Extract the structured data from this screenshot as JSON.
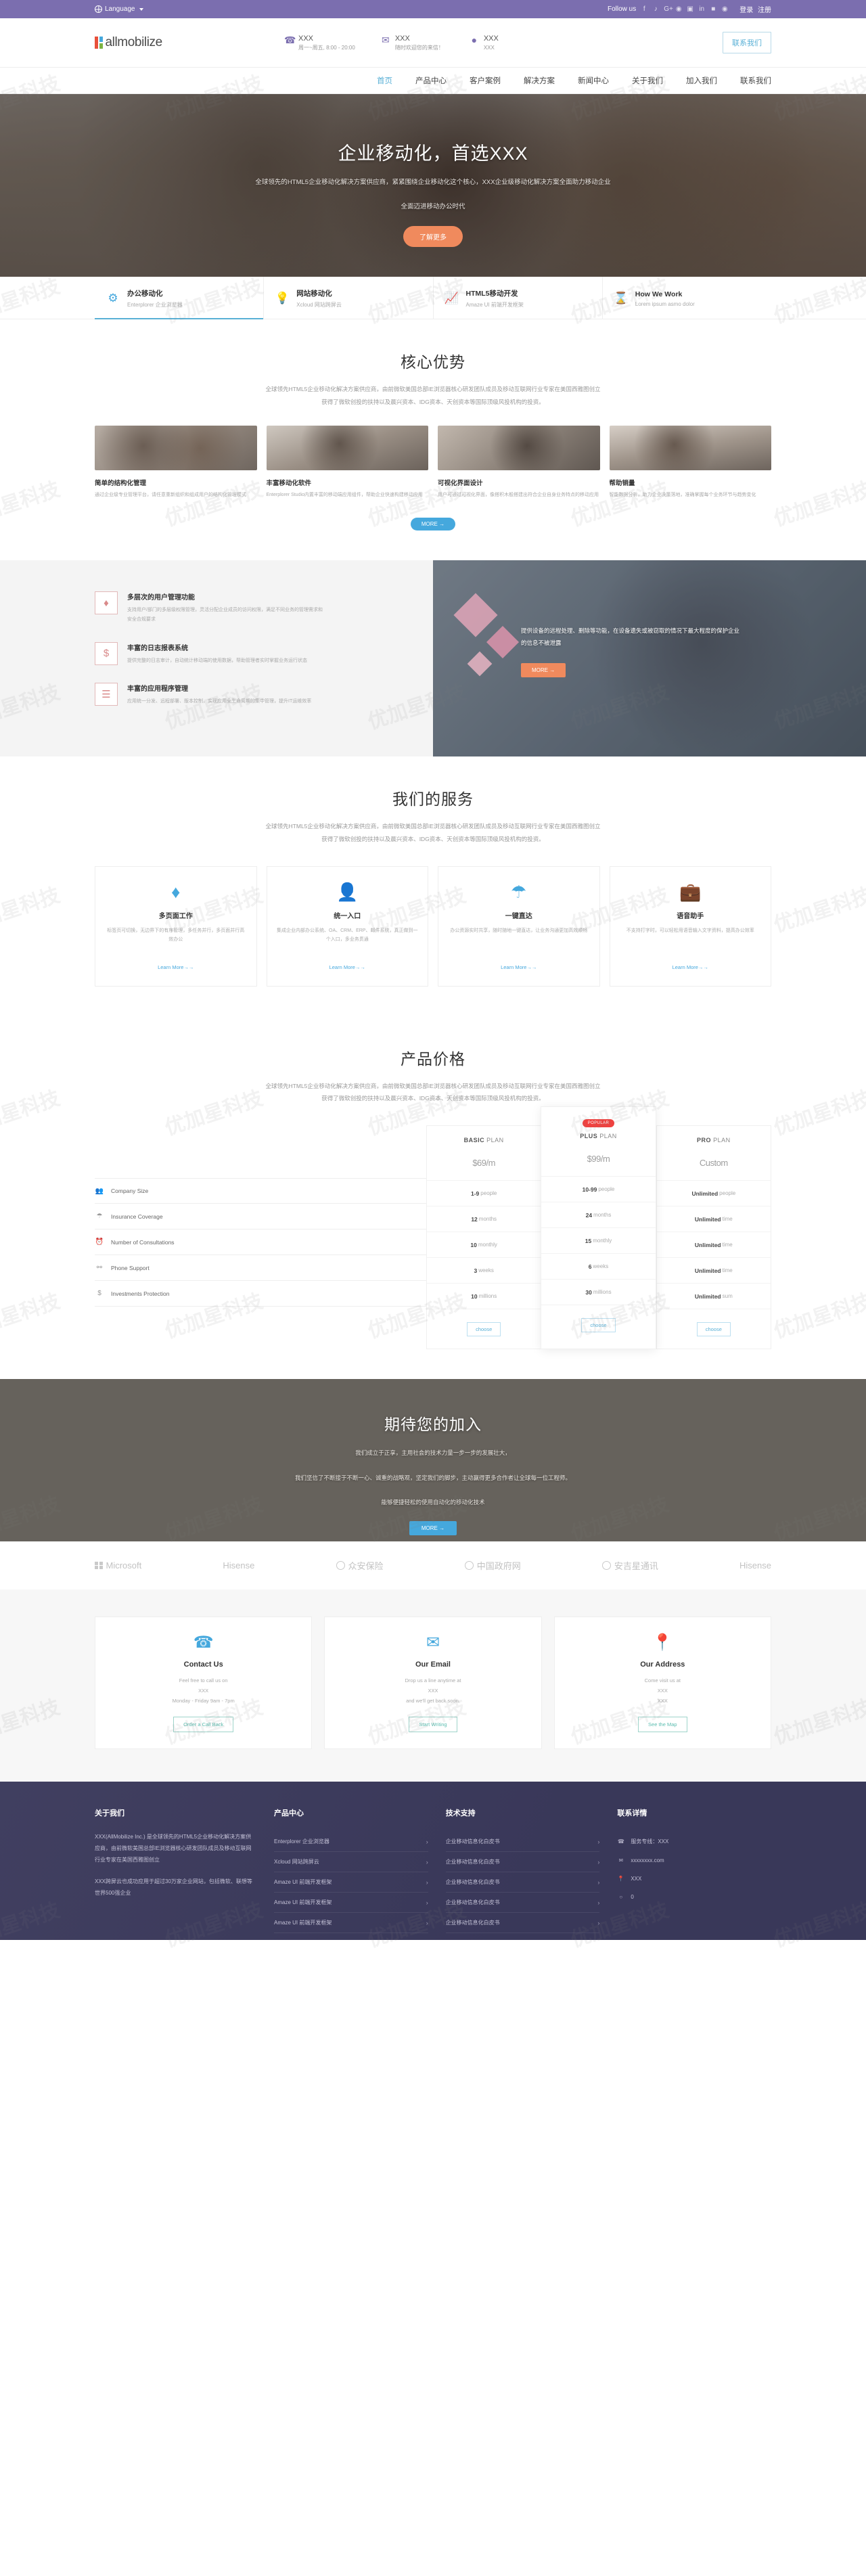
{
  "topbar": {
    "language": "Language",
    "follow_label": "Follow us",
    "social_icons": [
      "facebook-icon",
      "twitter-icon",
      "google-plus-icon",
      "pinterest-icon",
      "instagram-icon",
      "linkedin-icon",
      "flickr-icon",
      "rss-icon"
    ],
    "login": "登录",
    "register": "注册"
  },
  "header": {
    "logo_text": "allmobilize",
    "contacts": [
      {
        "icon": "phone-icon",
        "value": "XXX",
        "note": "周一~周五, 8:00 - 20:00"
      },
      {
        "icon": "envelope-icon",
        "value": "XXX",
        "note": "随时欢迎您的来信！"
      },
      {
        "icon": "location-pin-icon",
        "value": "XXX",
        "note": "XXX"
      }
    ],
    "contact_button": "联系我们"
  },
  "nav": {
    "items": [
      {
        "label": "首页",
        "active": true
      },
      {
        "label": "产品中心",
        "active": false
      },
      {
        "label": "客户案例",
        "active": false
      },
      {
        "label": "解决方案",
        "active": false
      },
      {
        "label": "新闻中心",
        "active": false
      },
      {
        "label": "关于我们",
        "active": false
      },
      {
        "label": "加入我们",
        "active": false
      },
      {
        "label": "联系我们",
        "active": false
      }
    ]
  },
  "hero": {
    "title": "企业移动化，首选XXX",
    "line1": "全球领先的HTML5企业移动化解决方案供应商，紧紧围绕企业移动化这个核心，XXX企业级移动化解决方案全面助力移动企业",
    "line2": "全面迈进移动办公时代",
    "cta": "了解更多"
  },
  "feature_tabs": [
    {
      "icon": "gear-icon",
      "title": "办公移动化",
      "sub": "Enterplorer 企业浏览器",
      "active": true
    },
    {
      "icon": "bulb-icon",
      "title": "网站移动化",
      "sub": "Xcloud 网站跨屏云",
      "active": false
    },
    {
      "icon": "chart-up-icon",
      "title": "HTML5移动开发",
      "sub": "Amaze UI 前端开发框架",
      "active": false
    },
    {
      "icon": "hourglass-icon",
      "title": "How We Work",
      "sub": "Lorem ipsum asmo dolor",
      "active": false
    }
  ],
  "advantages": {
    "title": "核心优势",
    "lead1": "全球领先HTML5企业移动化解决方案供应商，由前微软美国总部IE浏览器核心研发团队成员及移动互联网行业专家在美国西雅图创立",
    "lead2": "获得了微软创投的扶持以及晨兴资本、IDG资本、天创资本等国际顶级风投机构的投资。",
    "cards": [
      {
        "title": "简单的结构化管理",
        "desc": "通过企业级专业管理平台，请任意重新组织和组成用户的结构化管理模式"
      },
      {
        "title": "丰富移动化软件",
        "desc": "Enterplorer Studio内置丰富的移动端应用组件，帮助企业快速构建移动应用"
      },
      {
        "title": "可视化界面设计",
        "desc": "用户可通过可视化界面，像搭积木般搭建出符合企业自身业务特点的移动应用"
      },
      {
        "title": "帮助销量",
        "desc": "智能数据分析，助力企业决策落地，准确掌握每个业务环节与趋势变化"
      }
    ],
    "more": "MORE →"
  },
  "band": {
    "items": [
      {
        "icon": "diamond-icon",
        "title": "多层次的用户管理功能",
        "desc": "支持用户/部门的多层级权限管理，灵活分配企业成员的访问权限，满足不同业务的管理需求和安全合规要求"
      },
      {
        "icon": "dollar-icon",
        "title": "丰富的日志报表系统",
        "desc": "提供完整的日志审计，自动统计移动端的使用数据，帮助管理者实时掌握业务运行状态"
      },
      {
        "icon": "list-icon",
        "title": "丰富的应用程序管理",
        "desc": "应用统一分发、远程部署、版本控制，实现应用全生命周期的集中管理，提升IT运维效率"
      }
    ],
    "quote": "提供设备的远程处理、删除等功能，在设备遗失或被窃取的情况下最大程度的保护企业的信息不被泄露",
    "more": "MORE →"
  },
  "services": {
    "title": "我们的服务",
    "lead1": "全球领先HTML5企业移动化解决方案供应商，由前微软美国总部IE浏览器核心研发团队成员及移动互联网行业专家在美国西雅图创立",
    "lead2": "获得了微软创投的扶持以及晨兴资本、IDG资本、天创资本等国际顶级风投机构的投资。",
    "cards": [
      {
        "icon": "diamond-icon",
        "title": "多页面工作",
        "desc": "标签页可切换，无边界下的有序管理，多任务并行，多页面并行高效办公"
      },
      {
        "icon": "user-icon",
        "title": "统一入口",
        "desc": "集成企业内部办公系统、OA、CRM、ERP、邮件系统，真正做到一个入口，多业务贯通"
      },
      {
        "icon": "umbrella-icon",
        "title": "一键直达",
        "desc": "办公资源实时共享，随时随地一键直达，让业务沟通更加高效顺畅"
      },
      {
        "icon": "briefcase-icon",
        "title": "语音助手",
        "desc": "不支持打字时，可以轻松用语音输入文字资料，提高办公效率"
      }
    ],
    "learn_more": "Learn More→→"
  },
  "pricing": {
    "title": "产品价格",
    "lead1": "全球领先HTML5企业移动化解决方案供应商，由前微软美国总部IE浏览器核心研发团队成员及移动互联网行业专家在美国西雅图创立",
    "lead2": "获得了微软创投的扶持以及晨兴资本、IDG资本、天创资本等国际顶级风投机构的投资。",
    "features": [
      {
        "icon": "people-icon",
        "label": "Company Size"
      },
      {
        "icon": "umbrella-icon",
        "label": "Insurance Coverage"
      },
      {
        "icon": "clock-icon",
        "label": "Number of Consultations"
      },
      {
        "icon": "mic-icon",
        "label": "Phone Support"
      },
      {
        "icon": "dollar-icon",
        "label": "Investments Protection"
      }
    ],
    "plans": [
      {
        "badge": "",
        "name_bold": "BASIC",
        "name_rest": "PLAN",
        "price": "$69",
        "price_unit": "/m",
        "popular": false,
        "cells": [
          {
            "b": "1-9",
            "t": "people"
          },
          {
            "b": "12",
            "t": "months"
          },
          {
            "b": "10",
            "t": "monthly"
          },
          {
            "b": "3",
            "t": "weeks"
          },
          {
            "b": "10",
            "t": "millions"
          }
        ],
        "button": "choose"
      },
      {
        "badge": "POPULAR",
        "name_bold": "PLUS",
        "name_rest": "PLAN",
        "price": "$99",
        "price_unit": "/m",
        "popular": true,
        "cells": [
          {
            "b": "10-99",
            "t": "people"
          },
          {
            "b": "24",
            "t": "months"
          },
          {
            "b": "15",
            "t": "monthly"
          },
          {
            "b": "6",
            "t": "weeks"
          },
          {
            "b": "30",
            "t": "millions"
          }
        ],
        "button": "choose"
      },
      {
        "badge": "",
        "name_bold": "PRO",
        "name_rest": "PLAN",
        "price": "Custom",
        "price_unit": "",
        "popular": false,
        "cells": [
          {
            "b": "Unlimited",
            "t": "people"
          },
          {
            "b": "Unlimited",
            "t": "time"
          },
          {
            "b": "Unlimited",
            "t": "time"
          },
          {
            "b": "Unlimited",
            "t": "time"
          },
          {
            "b": "Unlimited",
            "t": "sum"
          }
        ],
        "button": "choose"
      }
    ]
  },
  "join": {
    "title": "期待您的加入",
    "line1": "我们成立于正享，主用社会的技术力量一步一步的发展壮大，",
    "line2": "我们坚信了不断接于不断一心、诚重的战略观，坚定我们的脚步，主动赢得更多合作者让全球每一位工程师。",
    "line3": "能够便捷轻松的使用自动化的移动化技术",
    "more": "MORE →"
  },
  "logos": [
    {
      "name": "Microsoft",
      "icon": "grid-squares-icon"
    },
    {
      "name": "Hisense",
      "icon": ""
    },
    {
      "name": "众安保险",
      "icon": "circle-icon"
    },
    {
      "name": "中国政府网",
      "icon": "circle-icon"
    },
    {
      "name": "安吉星通讯",
      "icon": "circle-icon"
    },
    {
      "name": "Hisense",
      "icon": ""
    }
  ],
  "contact_cards": [
    {
      "icon": "phone-icon",
      "title": "Contact Us",
      "l1": "Feel free to call us on",
      "l2": "XXX",
      "l3": "Monday - Friday 9am - 7pm",
      "button": "Order a Call Back"
    },
    {
      "icon": "mail-icon",
      "title": "Our Email",
      "l1": "Drop us a line anytime at",
      "l2": "XXX",
      "l3": "and we'll get back soon.",
      "button": "Start Writing"
    },
    {
      "icon": "pin-icon",
      "title": "Our Address",
      "l1": "Come visit us at",
      "l2": "XXX",
      "l3": "XXX",
      "button": "See the Map"
    }
  ],
  "footer": {
    "columns": [
      {
        "title": "关于我们",
        "about1": "XXX(AllMobilize Inc.) 是全球领先的HTML5企业移动化解决方案供应商，由前微软美国总部IE浏览器核心研发团队成员及移动互联网行业专家在美国西雅图创立",
        "about2": "XXX跨屏云也成功应用于超过30万家企业网站，包括微软、联想等世界500强企业"
      },
      {
        "title": "产品中心",
        "links": [
          "Enterplorer 企业浏览器",
          "Xcloud 网站跨屏云",
          "Amaze UI 前端开发框架",
          "Amaze UI 前端开发框架",
          "Amaze UI 前端开发框架"
        ]
      },
      {
        "title": "技术支持",
        "links": [
          "企业移动信息化白皮书",
          "企业移动信息化白皮书",
          "企业移动信息化白皮书",
          "企业移动信息化白皮书",
          "企业移动信息化白皮书"
        ]
      },
      {
        "title": "联系详情",
        "contacts": [
          {
            "icon": "phone-icon",
            "text": "服务专线：XXX"
          },
          {
            "icon": "mail-icon",
            "text": "xxxxxxxx.com"
          },
          {
            "icon": "pin-icon",
            "text": "XXX"
          },
          {
            "icon": "qq-icon",
            "text": "0"
          }
        ]
      }
    ]
  },
  "watermark": "优加星科技"
}
